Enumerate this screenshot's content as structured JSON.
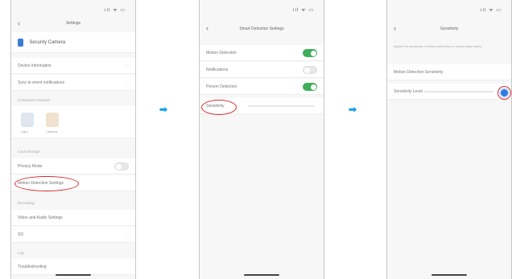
{
  "flow": {
    "arrow": "➡"
  },
  "screen1": {
    "status": "ııl ᯤ ▭",
    "back": "‹",
    "title": "Settings",
    "device_name": "Security Camera",
    "rows": [
      "Device Information",
      "Sync to event notifications"
    ],
    "section1": "Companion Devices",
    "devices": [
      "Light",
      "Camera"
    ],
    "section2": "Local Storage",
    "toggle_row": "Privacy Mode",
    "highlight_row": "Motion Detection Settings",
    "section3": "Recording",
    "rows2": [
      "Video and Audio Settings",
      "SD"
    ],
    "section4": "Log",
    "last_row": "Troubleshooting"
  },
  "screen2": {
    "status": "ııl ᯤ ▭",
    "back": "‹",
    "title": "Smart Detection Settings",
    "rows": [
      {
        "label": "Motion Detection",
        "on": true
      },
      {
        "label": "Notifications",
        "on": false
      },
      {
        "label": "Person Detection",
        "on": true
      }
    ],
    "highlight_row": "Sensitivity"
  },
  "screen3": {
    "status": "ııl ᯤ ▭",
    "back": "‹",
    "title": "Sensitivity",
    "description": "Adjust the sensitivity of motion detection to reduce false alerts",
    "row1": "Motion Detection Sensitivity",
    "row2": "Sensitivity Level",
    "slider_level": 1.0
  }
}
